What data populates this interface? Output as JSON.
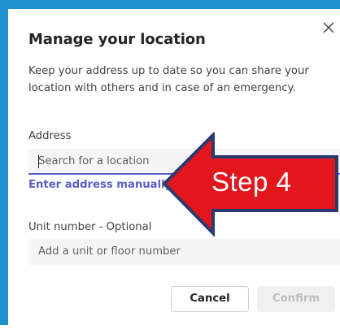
{
  "dialog": {
    "title": "Manage your location",
    "description": "Keep your address up to date so you can share your location with others and in case of an emergency."
  },
  "address": {
    "label": "Address",
    "placeholder": "Search for a location",
    "link": "Enter address manually"
  },
  "unit": {
    "label": "Unit number - Optional",
    "placeholder": "Add a unit or floor number"
  },
  "buttons": {
    "cancel": "Cancel",
    "confirm": "Confirm"
  },
  "annotation": {
    "text": "Step 4"
  },
  "colors": {
    "frame": "#1e8fcf",
    "accent": "#5b5fc7",
    "arrow_fill": "#e3161e",
    "arrow_outline": "#2a3a6e"
  },
  "icons": {
    "close": "close-icon",
    "search": "search-icon"
  }
}
